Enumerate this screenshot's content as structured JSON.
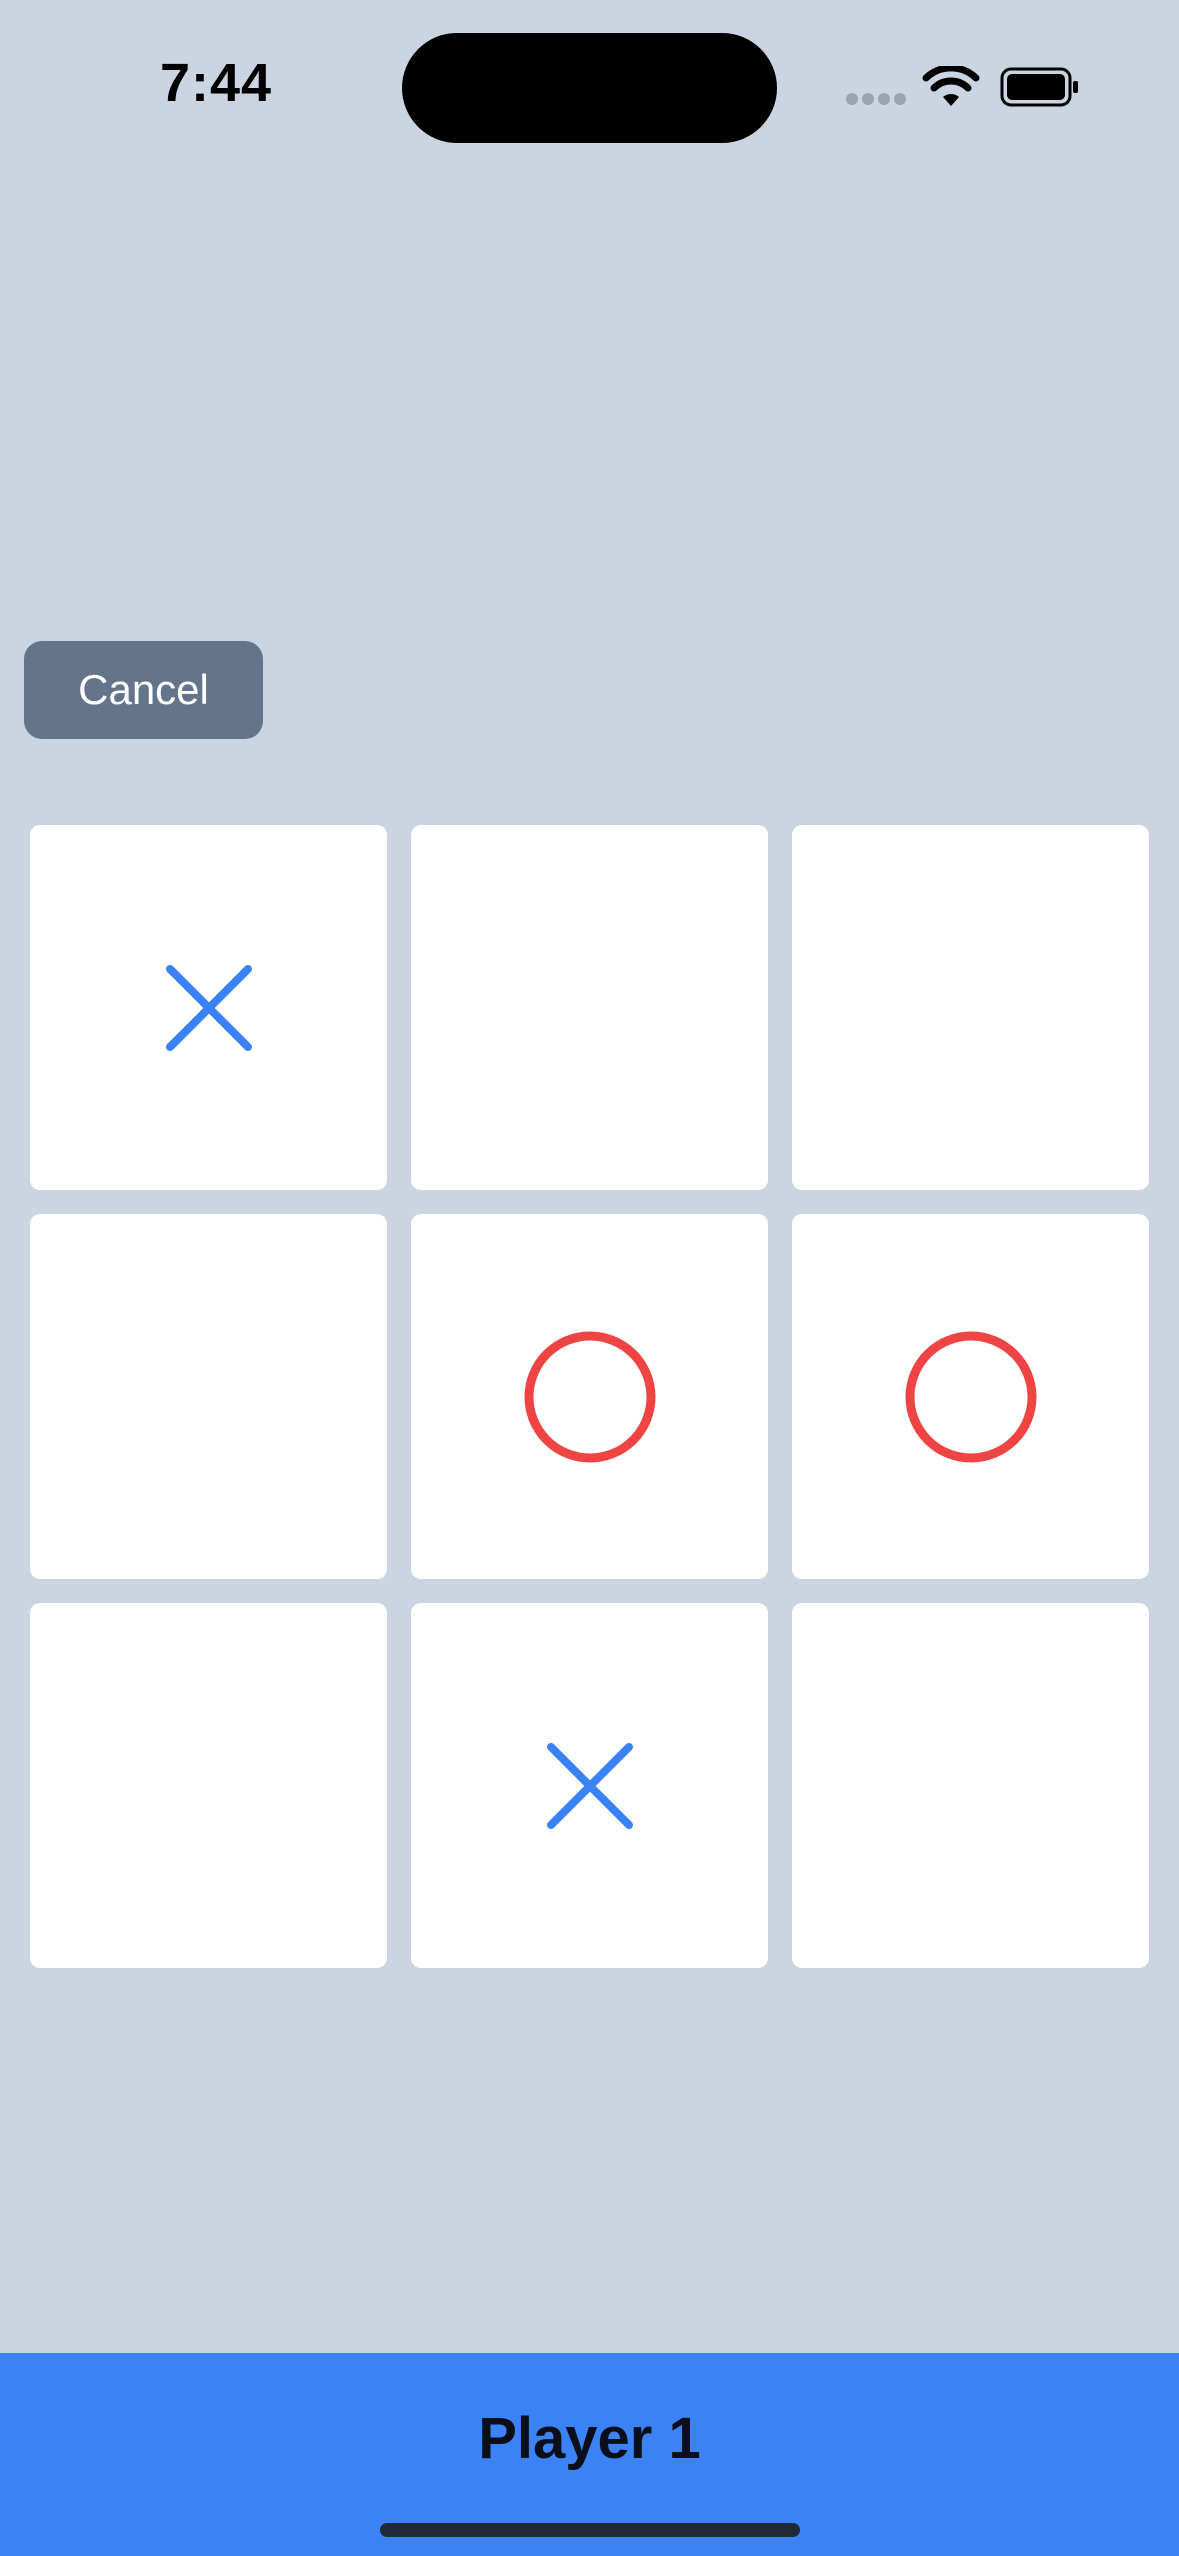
{
  "status_bar": {
    "time": "7:44"
  },
  "cancel_button": {
    "label": "Cancel"
  },
  "board": {
    "cells": [
      "X",
      "",
      "",
      "",
      "O",
      "O",
      "",
      "X",
      ""
    ],
    "x_color": "#3b82f6",
    "o_color": "#ef4444"
  },
  "turn": {
    "label": "Player 1"
  },
  "colors": {
    "background": "#cbd5e1",
    "footer": "#3b82f6",
    "cancel": "#64748b"
  }
}
